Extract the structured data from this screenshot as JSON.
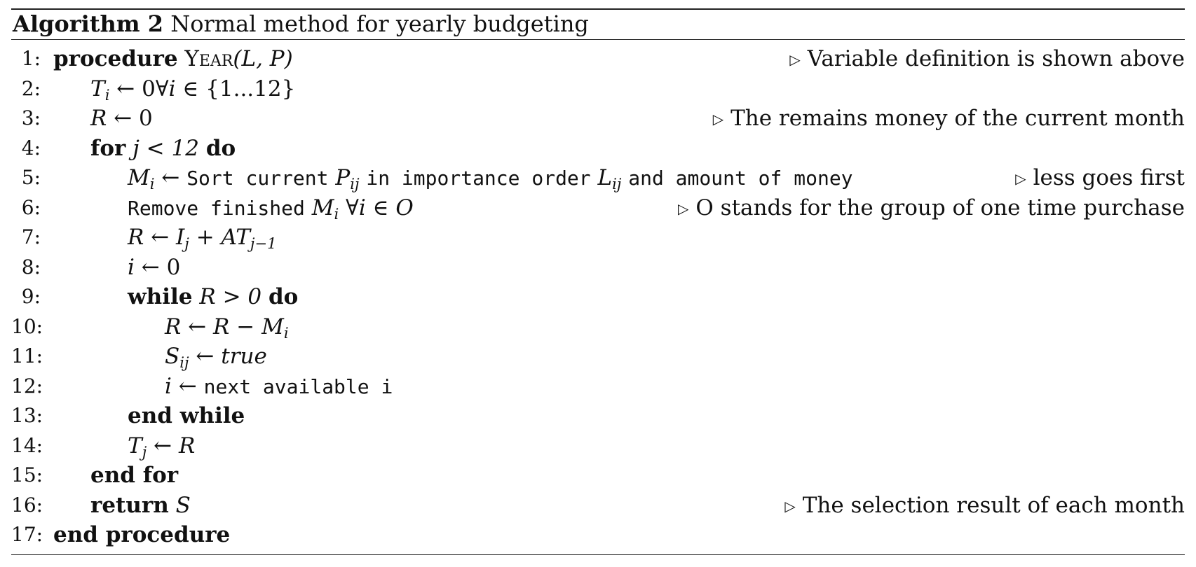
{
  "caption": {
    "label": "Algorithm 2",
    "title": "Normal method for yearly budgeting"
  },
  "comment_marker": "▷",
  "lines": [
    {
      "no": "1:",
      "kw": "procedure",
      "name": "Year",
      "args": "(L, P)",
      "comment": "Variable definition is shown above"
    },
    {
      "no": "2:",
      "T": "T",
      "sub": "i",
      "rest": "← 0∀",
      "i": "i",
      "set": "∈ {1...12}"
    },
    {
      "no": "3:",
      "R": "R",
      "rest": "← 0",
      "comment": "The remains money of the current month"
    },
    {
      "no": "4:",
      "kw": "for",
      "cond": "j < 12",
      "kw2": "do"
    },
    {
      "no": "5:",
      "M": "M",
      "sub": "i",
      "arrow": "←",
      "t1": "Sort current",
      "P": "P",
      "psub": "ij",
      "t2": "in importance order",
      "L": "L",
      "lsub": "ij",
      "t3": "and amount of money",
      "comment": "less goes first"
    },
    {
      "no": "6:",
      "t1": "Remove finished",
      "M": "M",
      "sub": "i",
      "rest": "∀",
      "i": "i",
      "set": "∈",
      "O": "O",
      "comment": "O stands for the group of one time purchase"
    },
    {
      "no": "7:",
      "R": "R",
      "arrow": "←",
      "I": "I",
      "isub": "j",
      "plus": "+",
      "AT": "AT",
      "atsub": "j−1"
    },
    {
      "no": "8:",
      "i": "i",
      "rest": "← 0"
    },
    {
      "no": "9:",
      "kw": "while",
      "cond": "R > 0",
      "kw2": "do"
    },
    {
      "no": "10:",
      "R": "R",
      "arrow": "←",
      "R2": "R",
      "minus": "−",
      "M": "M",
      "sub": "i"
    },
    {
      "no": "11:",
      "S": "S",
      "sub": "ij",
      "arrow": "←",
      "val": "true"
    },
    {
      "no": "12:",
      "i": "i",
      "arrow": "←",
      "t1": "next available i"
    },
    {
      "no": "13:",
      "kw": "end while"
    },
    {
      "no": "14:",
      "T": "T",
      "sub": "j",
      "arrow": "←",
      "R": "R"
    },
    {
      "no": "15:",
      "kw": "end for"
    },
    {
      "no": "16:",
      "kw": "return",
      "S": "S",
      "comment": "The selection result of each month"
    },
    {
      "no": "17:",
      "kw": "end procedure"
    }
  ]
}
